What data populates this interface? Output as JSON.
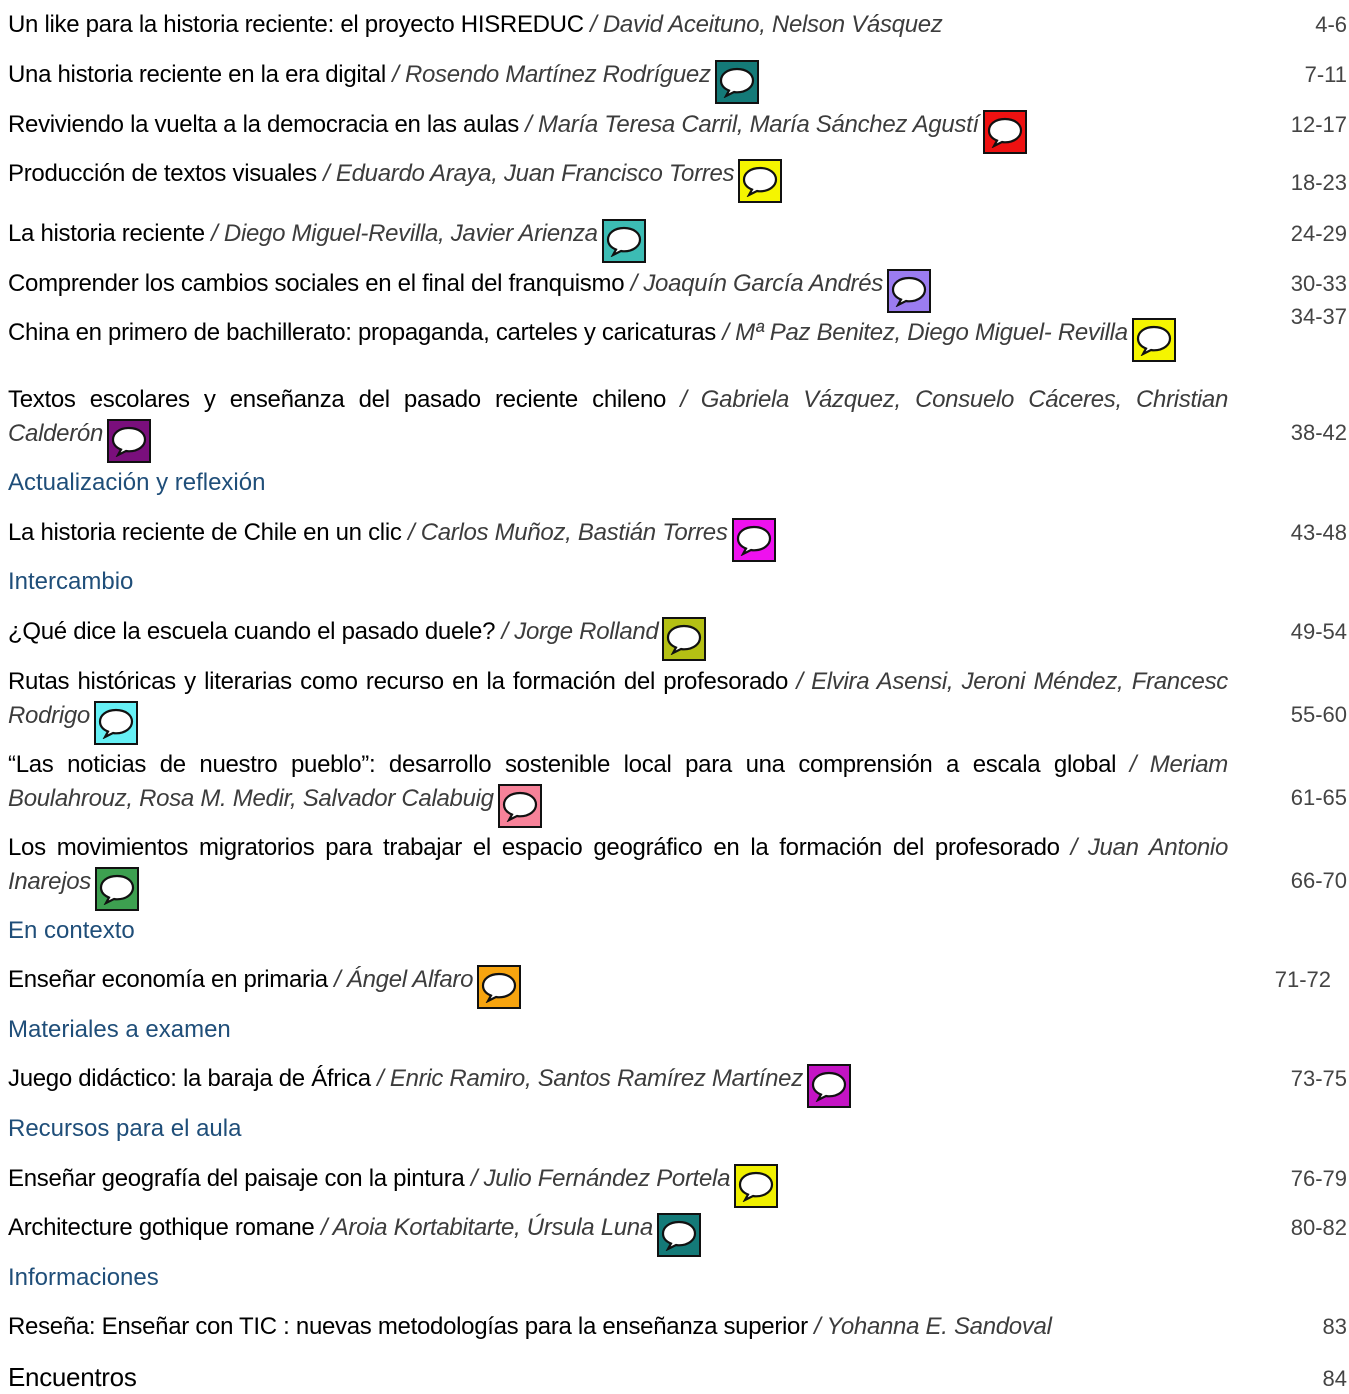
{
  "entries": [
    {
      "title": "Un like para la historia reciente: el proyecto HISREDUC",
      "authors": "David Aceituno, Nelson Vásquez",
      "pages": "4-6",
      "icon": null
    },
    {
      "title": "Una historia reciente en la era digital",
      "authors": "Rosendo Martínez Rodríguez",
      "pages": "7-11",
      "icon": "#147a78"
    },
    {
      "title": "Reviviendo la vuelta a la democracia en las aulas",
      "authors": "María Teresa Carril, María Sánchez Agustí",
      "pages": "12-17",
      "icon": "#ee1111"
    },
    {
      "title": "Producción de textos visuales",
      "authors": "Eduardo Araya, Juan Francisco Torres",
      "pages": "18-23",
      "icon": "#f5f500"
    },
    {
      "title": "La historia reciente",
      "authors": "Diego Miguel-Revilla, Javier Arienza",
      "pages": "24-29",
      "icon": "#3cbcb4"
    },
    {
      "title": "Comprender los cambios sociales en el final del franquismo",
      "authors": "Joaquín García Andrés",
      "pages": "30-33",
      "icon": "#9b7cf0"
    },
    {
      "title": "China en primero de bachillerato: propaganda, carteles y caricaturas",
      "authors": "Mª Paz Benitez, Diego Miguel- Revilla",
      "pages": "34-37",
      "icon": "#f5f500"
    },
    {
      "title": "Textos escolares y enseñanza del pasado reciente chileno",
      "authors": "Gabriela Vázquez, Consuelo Cáceres, Christian Calderón",
      "pages": "38-42",
      "icon": "#7a0f7c"
    },
    {
      "section": "Actualización y reflexión"
    },
    {
      "title": "La historia reciente de Chile en un clic",
      "authors": "Carlos Muñoz, Bastián Torres",
      "pages": "43-48",
      "icon": "#ee11ee"
    },
    {
      "section": "Intercambio"
    },
    {
      "title": "¿Qué dice la escuela cuando el pasado duele?",
      "authors": "Jorge Rolland",
      "pages": "49-54",
      "icon": "#b4c014"
    },
    {
      "title": "Rutas históricas y literarias como recurso en la formación del profesorado",
      "authors": "Elvira Asensi, Jeroni Méndez, Francesc Rodrigo",
      "pages": "55-60",
      "icon": "#66f0f5"
    },
    {
      "title": "“Las noticias de nuestro pueblo”: desarrollo sostenible local para una comprensión a escala global",
      "authors": "Meriam Boulahrouz, Rosa M. Medir, Salvador Calabuig",
      "pages": "61-65",
      "icon": "#f78299"
    },
    {
      "title": "Los movimientos migratorios para trabajar el espacio geográfico en la formación del profesorado",
      "authors": "Juan Antonio Inarejos",
      "pages": "66-70",
      "icon": "#3da050"
    },
    {
      "section": "En contexto"
    },
    {
      "title": "Enseñar economía en primaria",
      "authors": "Ángel Alfaro",
      "pages": "71-72",
      "icon": "#f7a40f"
    },
    {
      "section": "Materiales a examen"
    },
    {
      "title": "Juego didáctico: la  baraja de África",
      "authors": "Enric Ramiro, Santos Ramírez Martínez",
      "pages": "73-75",
      "icon": "#c414c4"
    },
    {
      "section": "Recursos para el aula"
    },
    {
      "title": "Enseñar geografía del paisaje con la pintura",
      "authors": "Julio Fernández Portela",
      "pages": "76-79",
      "icon": "#f0f000"
    },
    {
      "title": "Architecture gothique romane",
      "authors": "Aroia Kortabitarte, Úrsula Luna",
      "pages": "80-82",
      "icon": "#147a78"
    },
    {
      "section": "Informaciones"
    },
    {
      "title": "Reseña:  Enseñar con TIC : nuevas metodologías para la enseñanza superior",
      "authors": "Yohanna E. Sandoval",
      "pages": "83",
      "icon": null
    },
    {
      "title": "Encuentros",
      "authors": "",
      "pages": "84",
      "icon": null,
      "big": true
    }
  ]
}
